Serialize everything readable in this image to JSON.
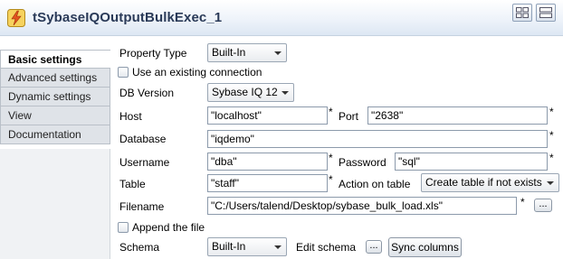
{
  "header": {
    "title": "tSybaseIQOutputBulkExec_1",
    "component_icon": "lightning-component-icon",
    "view_buttons": [
      "grid-view-icon",
      "list-view-icon"
    ]
  },
  "sidebar": {
    "tabs": [
      {
        "label": "Basic settings",
        "active": true
      },
      {
        "label": "Advanced settings",
        "active": false
      },
      {
        "label": "Dynamic settings",
        "active": false
      },
      {
        "label": "View",
        "active": false
      },
      {
        "label": "Documentation",
        "active": false
      }
    ]
  },
  "form": {
    "property_type": {
      "label": "Property Type",
      "value": "Built-In"
    },
    "use_existing_connection": {
      "label": "Use an existing connection",
      "checked": false
    },
    "db_version": {
      "label": "DB Version",
      "value": "Sybase IQ 12"
    },
    "host": {
      "label": "Host",
      "value": "\"localhost\""
    },
    "port": {
      "label": "Port",
      "value": "\"2638\""
    },
    "database": {
      "label": "Database",
      "value": "\"iqdemo\""
    },
    "username": {
      "label": "Username",
      "value": "\"dba\""
    },
    "password": {
      "label": "Password",
      "value": "\"sql\""
    },
    "table": {
      "label": "Table",
      "value": "\"staff\""
    },
    "action_on_table": {
      "label": "Action on table",
      "value": "Create table if not exists"
    },
    "filename": {
      "label": "Filename",
      "value": "\"C:/Users/talend/Desktop/sybase_bulk_load.xls\"",
      "browse_label": "..."
    },
    "append_file": {
      "label": "Append the file",
      "checked": false
    },
    "schema": {
      "label": "Schema",
      "value": "Built-In"
    },
    "edit_schema": {
      "label": "Edit schema",
      "button_label": "..."
    },
    "sync_columns": {
      "label": "Sync columns"
    },
    "required_marker": "*"
  },
  "colors": {
    "title_text": "#2a3a58",
    "header_gradient_end": "#dde7f3",
    "sidebar_bg": "#dfe3e8",
    "field_border": "#8c9aab"
  }
}
